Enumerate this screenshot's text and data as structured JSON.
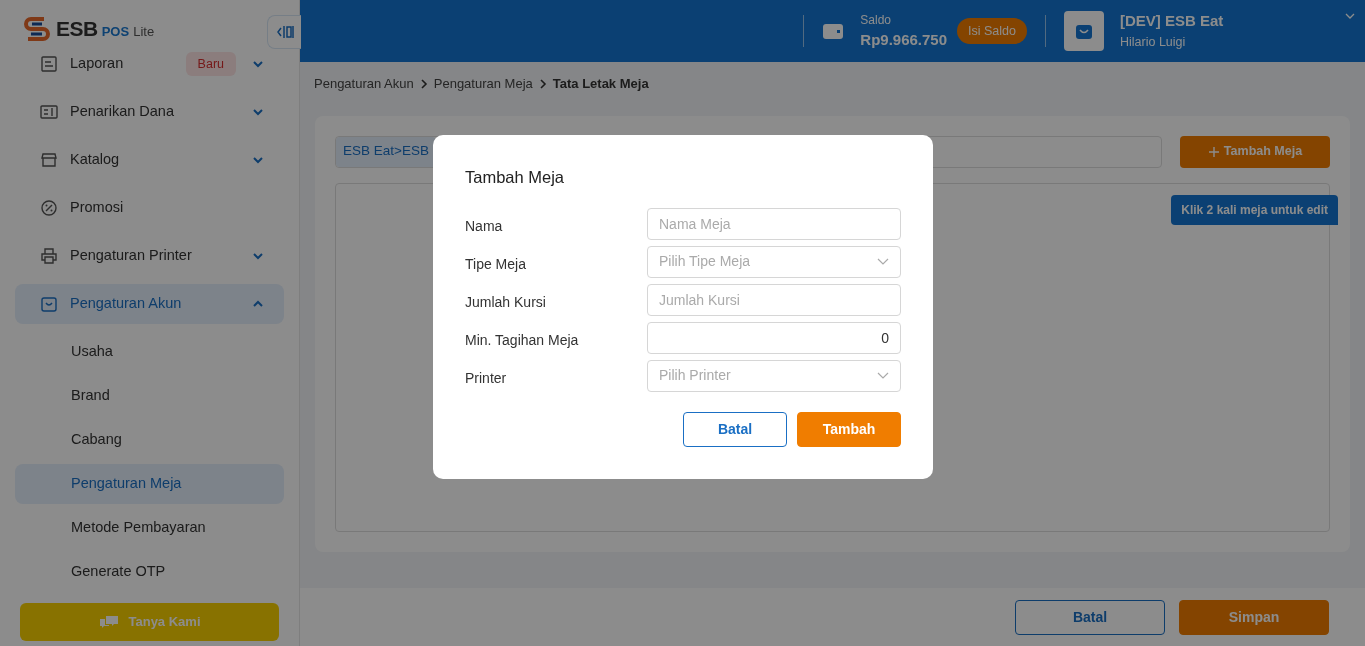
{
  "logo": {
    "brand": "ESB",
    "product": "POS",
    "suffix": "Lite"
  },
  "sidebar": {
    "items": [
      {
        "label": "Laporan",
        "kind": "group",
        "badge": "Baru",
        "expanded": false,
        "selected": false
      },
      {
        "label": "Penarikan Dana",
        "kind": "group",
        "expanded": false,
        "selected": false
      },
      {
        "label": "Katalog",
        "kind": "group",
        "expanded": false,
        "selected": false
      },
      {
        "label": "Promosi",
        "kind": "link",
        "selected": false
      },
      {
        "label": "Pengaturan Printer",
        "kind": "group",
        "expanded": false,
        "selected": false
      },
      {
        "label": "Pengaturan Akun",
        "kind": "group",
        "expanded": true,
        "selected": true,
        "children": [
          {
            "label": "Usaha",
            "selected": false
          },
          {
            "label": "Brand",
            "selected": false
          },
          {
            "label": "Cabang",
            "selected": false
          },
          {
            "label": "Pengaturan Meja",
            "selected": true
          },
          {
            "label": "Metode Pembayaran",
            "selected": false
          },
          {
            "label": "Generate OTP",
            "selected": false
          }
        ]
      }
    ],
    "help_button": "Tanya Kami"
  },
  "header": {
    "balance_label": "Saldo",
    "balance": "Rp9.966.750",
    "topup_button": "Isi Saldo",
    "store_name": "[DEV] ESB Eat",
    "user_name": "Hilario Luigi"
  },
  "breadcrumb": [
    {
      "label": "Pengaturan Akun",
      "current": false
    },
    {
      "label": "Pengaturan Meja",
      "current": false
    },
    {
      "label": "Tata Letak Meja",
      "current": true
    }
  ],
  "layout_editor": {
    "path_chip": "ESB Eat>ESB",
    "add_button": "Tambah Meja",
    "hint": "Klik 2 kali meja untuk edit"
  },
  "footer": {
    "buttons": [
      {
        "label": "Batal",
        "kind": "secondary"
      },
      {
        "label": "Simpan",
        "kind": "primary"
      }
    ]
  },
  "modal": {
    "title": "Tambah Meja",
    "fields": [
      {
        "label": "Nama",
        "kind": "text",
        "placeholder": "Nama Meja"
      },
      {
        "label": "Tipe Meja",
        "kind": "select",
        "placeholder": "Pilih Tipe Meja"
      },
      {
        "label": "Jumlah Kursi",
        "kind": "text",
        "placeholder": "Jumlah Kursi"
      },
      {
        "label": "Min. Tagihan Meja",
        "kind": "number",
        "value": "0"
      },
      {
        "label": "Printer",
        "kind": "select",
        "placeholder": "Pilih Printer"
      }
    ],
    "buttons": [
      {
        "label": "Batal",
        "kind": "secondary"
      },
      {
        "label": "Tambah",
        "kind": "primary"
      }
    ]
  }
}
